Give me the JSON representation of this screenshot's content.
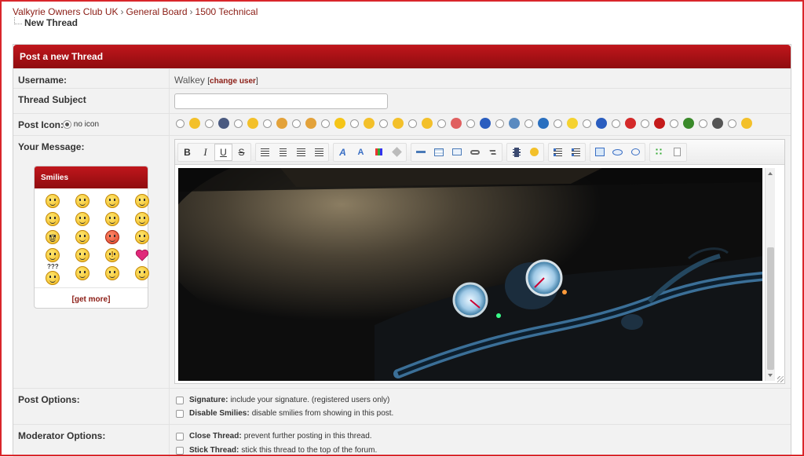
{
  "breadcrumb": {
    "items": [
      "Valkyrie Owners Club UK",
      "General Board",
      "1500 Technical"
    ],
    "separator": "›",
    "current": "New Thread"
  },
  "panel": {
    "title": "Post a new Thread"
  },
  "username": {
    "label": "Username:",
    "value": "Walkey",
    "change_link": "change user",
    "open_bracket": "[",
    "close_bracket": "]"
  },
  "subject": {
    "label": "Thread Subject",
    "value": ""
  },
  "post_icon": {
    "label": "Post Icon:",
    "no_icon_label": "no icon",
    "icons": [
      {
        "name": "smile-icon",
        "color": "#f3c02a"
      },
      {
        "name": "film-icon",
        "color": "#4a5a80"
      },
      {
        "name": "grin-icon",
        "color": "#f3c02a"
      },
      {
        "name": "thumbs-up-icon",
        "color": "#e3a23a"
      },
      {
        "name": "thumbs-down-icon",
        "color": "#e3a23a"
      },
      {
        "name": "star-icon",
        "color": "#f5c518"
      },
      {
        "name": "sad-icon",
        "color": "#f3c02a"
      },
      {
        "name": "angry-icon",
        "color": "#f3c02a"
      },
      {
        "name": "wink-icon",
        "color": "#f3c02a"
      },
      {
        "name": "rainbow-icon",
        "color": "#e06060"
      },
      {
        "name": "question-icon",
        "color": "#2a5dbf"
      },
      {
        "name": "picture-icon",
        "color": "#5a8ac0"
      },
      {
        "name": "music-icon",
        "color": "#2a6fbf"
      },
      {
        "name": "lightbulb-icon",
        "color": "#f5d230"
      },
      {
        "name": "info-icon",
        "color": "#2a5dbf"
      },
      {
        "name": "heart-icon",
        "color": "#d42a2a"
      },
      {
        "name": "exclamation-icon",
        "color": "#c41a1a"
      },
      {
        "name": "bug-icon",
        "color": "#3a8a2a"
      },
      {
        "name": "keyboard-icon",
        "color": "#555555"
      },
      {
        "name": "laugh-icon",
        "color": "#f3c02a"
      }
    ]
  },
  "message": {
    "label": "Your Message:"
  },
  "toolbar": {
    "bold": "B",
    "italic": "I",
    "underline": "U",
    "strike": "S",
    "font_label": "A",
    "size_label": "A"
  },
  "smilies": {
    "title": "Smilies",
    "more_link": "get more",
    "open_bracket": "[",
    "close_bracket": "]",
    "puzzled_text": "???",
    "at_text": "@",
    "alert_text": "!"
  },
  "post_options": {
    "label": "Post Options:",
    "items": [
      {
        "title": "Signature:",
        "desc": "include your signature. (registered users only)"
      },
      {
        "title": "Disable Smilies:",
        "desc": "disable smilies from showing in this post."
      }
    ]
  },
  "moderator_options": {
    "label": "Moderator Options:",
    "items": [
      {
        "title": "Close Thread:",
        "desc": "prevent further posting in this thread."
      },
      {
        "title": "Stick Thread:",
        "desc": "stick this thread to the top of the forum."
      }
    ]
  }
}
